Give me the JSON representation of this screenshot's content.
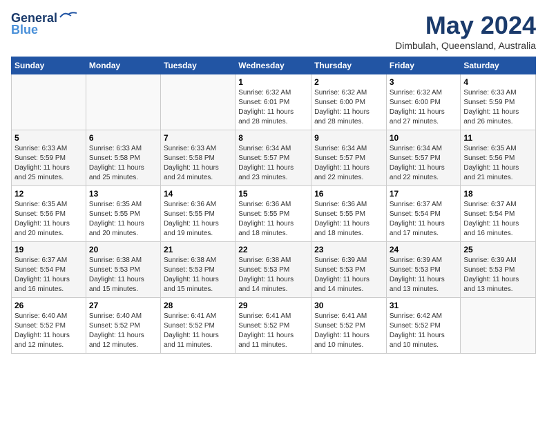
{
  "logo": {
    "text1": "General",
    "text2": "Blue"
  },
  "title": "May 2024",
  "subtitle": "Dimbulah, Queensland, Australia",
  "weekdays": [
    "Sunday",
    "Monday",
    "Tuesday",
    "Wednesday",
    "Thursday",
    "Friday",
    "Saturday"
  ],
  "weeks": [
    [
      {
        "day": "",
        "info": ""
      },
      {
        "day": "",
        "info": ""
      },
      {
        "day": "",
        "info": ""
      },
      {
        "day": "1",
        "info": "Sunrise: 6:32 AM\nSunset: 6:01 PM\nDaylight: 11 hours\nand 28 minutes."
      },
      {
        "day": "2",
        "info": "Sunrise: 6:32 AM\nSunset: 6:00 PM\nDaylight: 11 hours\nand 28 minutes."
      },
      {
        "day": "3",
        "info": "Sunrise: 6:32 AM\nSunset: 6:00 PM\nDaylight: 11 hours\nand 27 minutes."
      },
      {
        "day": "4",
        "info": "Sunrise: 6:33 AM\nSunset: 5:59 PM\nDaylight: 11 hours\nand 26 minutes."
      }
    ],
    [
      {
        "day": "5",
        "info": "Sunrise: 6:33 AM\nSunset: 5:59 PM\nDaylight: 11 hours\nand 25 minutes."
      },
      {
        "day": "6",
        "info": "Sunrise: 6:33 AM\nSunset: 5:58 PM\nDaylight: 11 hours\nand 25 minutes."
      },
      {
        "day": "7",
        "info": "Sunrise: 6:33 AM\nSunset: 5:58 PM\nDaylight: 11 hours\nand 24 minutes."
      },
      {
        "day": "8",
        "info": "Sunrise: 6:34 AM\nSunset: 5:57 PM\nDaylight: 11 hours\nand 23 minutes."
      },
      {
        "day": "9",
        "info": "Sunrise: 6:34 AM\nSunset: 5:57 PM\nDaylight: 11 hours\nand 22 minutes."
      },
      {
        "day": "10",
        "info": "Sunrise: 6:34 AM\nSunset: 5:57 PM\nDaylight: 11 hours\nand 22 minutes."
      },
      {
        "day": "11",
        "info": "Sunrise: 6:35 AM\nSunset: 5:56 PM\nDaylight: 11 hours\nand 21 minutes."
      }
    ],
    [
      {
        "day": "12",
        "info": "Sunrise: 6:35 AM\nSunset: 5:56 PM\nDaylight: 11 hours\nand 20 minutes."
      },
      {
        "day": "13",
        "info": "Sunrise: 6:35 AM\nSunset: 5:55 PM\nDaylight: 11 hours\nand 20 minutes."
      },
      {
        "day": "14",
        "info": "Sunrise: 6:36 AM\nSunset: 5:55 PM\nDaylight: 11 hours\nand 19 minutes."
      },
      {
        "day": "15",
        "info": "Sunrise: 6:36 AM\nSunset: 5:55 PM\nDaylight: 11 hours\nand 18 minutes."
      },
      {
        "day": "16",
        "info": "Sunrise: 6:36 AM\nSunset: 5:55 PM\nDaylight: 11 hours\nand 18 minutes."
      },
      {
        "day": "17",
        "info": "Sunrise: 6:37 AM\nSunset: 5:54 PM\nDaylight: 11 hours\nand 17 minutes."
      },
      {
        "day": "18",
        "info": "Sunrise: 6:37 AM\nSunset: 5:54 PM\nDaylight: 11 hours\nand 16 minutes."
      }
    ],
    [
      {
        "day": "19",
        "info": "Sunrise: 6:37 AM\nSunset: 5:54 PM\nDaylight: 11 hours\nand 16 minutes."
      },
      {
        "day": "20",
        "info": "Sunrise: 6:38 AM\nSunset: 5:53 PM\nDaylight: 11 hours\nand 15 minutes."
      },
      {
        "day": "21",
        "info": "Sunrise: 6:38 AM\nSunset: 5:53 PM\nDaylight: 11 hours\nand 15 minutes."
      },
      {
        "day": "22",
        "info": "Sunrise: 6:38 AM\nSunset: 5:53 PM\nDaylight: 11 hours\nand 14 minutes."
      },
      {
        "day": "23",
        "info": "Sunrise: 6:39 AM\nSunset: 5:53 PM\nDaylight: 11 hours\nand 14 minutes."
      },
      {
        "day": "24",
        "info": "Sunrise: 6:39 AM\nSunset: 5:53 PM\nDaylight: 11 hours\nand 13 minutes."
      },
      {
        "day": "25",
        "info": "Sunrise: 6:39 AM\nSunset: 5:53 PM\nDaylight: 11 hours\nand 13 minutes."
      }
    ],
    [
      {
        "day": "26",
        "info": "Sunrise: 6:40 AM\nSunset: 5:52 PM\nDaylight: 11 hours\nand 12 minutes."
      },
      {
        "day": "27",
        "info": "Sunrise: 6:40 AM\nSunset: 5:52 PM\nDaylight: 11 hours\nand 12 minutes."
      },
      {
        "day": "28",
        "info": "Sunrise: 6:41 AM\nSunset: 5:52 PM\nDaylight: 11 hours\nand 11 minutes."
      },
      {
        "day": "29",
        "info": "Sunrise: 6:41 AM\nSunset: 5:52 PM\nDaylight: 11 hours\nand 11 minutes."
      },
      {
        "day": "30",
        "info": "Sunrise: 6:41 AM\nSunset: 5:52 PM\nDaylight: 11 hours\nand 10 minutes."
      },
      {
        "day": "31",
        "info": "Sunrise: 6:42 AM\nSunset: 5:52 PM\nDaylight: 11 hours\nand 10 minutes."
      },
      {
        "day": "",
        "info": ""
      }
    ]
  ]
}
